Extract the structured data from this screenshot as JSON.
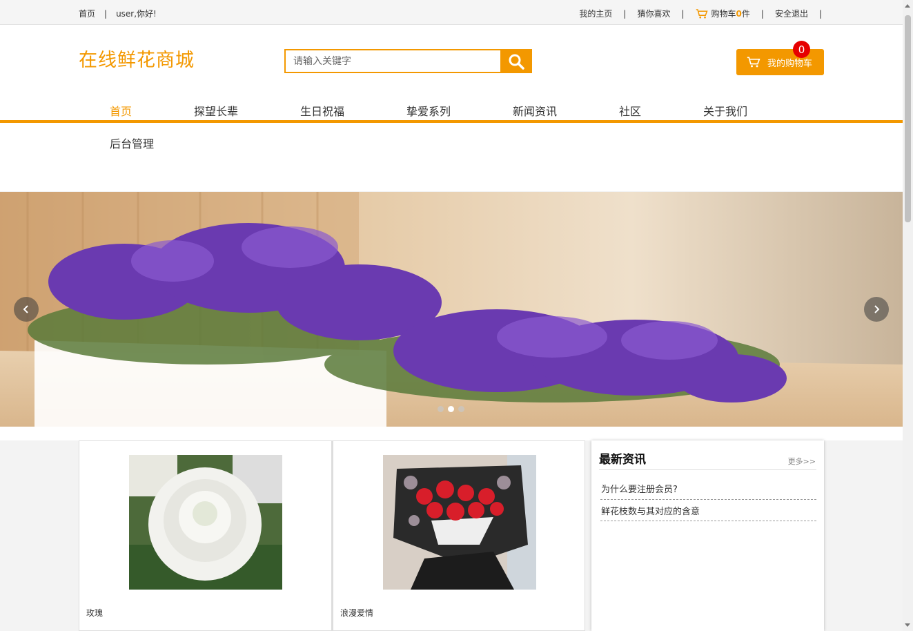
{
  "topbar": {
    "home": "首页",
    "separator": "|",
    "greeting": "user,你好!",
    "my_home": "我的主页",
    "guess": "猜你喜欢",
    "cart_label": "购物车",
    "cart_count": "0",
    "cart_unit": "件",
    "logout": "安全退出"
  },
  "header": {
    "logo": "在线鲜花商城",
    "search_placeholder": "请输入关键字",
    "cart_button": "我的购物车",
    "cart_badge": "0"
  },
  "nav": {
    "items": [
      "首页",
      "探望长辈",
      "生日祝福",
      "挚爱系列",
      "新闻资讯",
      "社区",
      "关于我们"
    ],
    "admin": "后台管理"
  },
  "banner": {
    "active_slide": 2,
    "slide_count": 3
  },
  "products": [
    {
      "name": "玫瑰"
    },
    {
      "name": "浪漫爱情"
    }
  ],
  "news": {
    "title": "最新资讯",
    "more": "更多>>",
    "items": [
      "为什么要注册会员?",
      "鲜花枝数与其对应的含意"
    ]
  },
  "colors": {
    "accent": "#f39800",
    "badge": "#e60000"
  }
}
